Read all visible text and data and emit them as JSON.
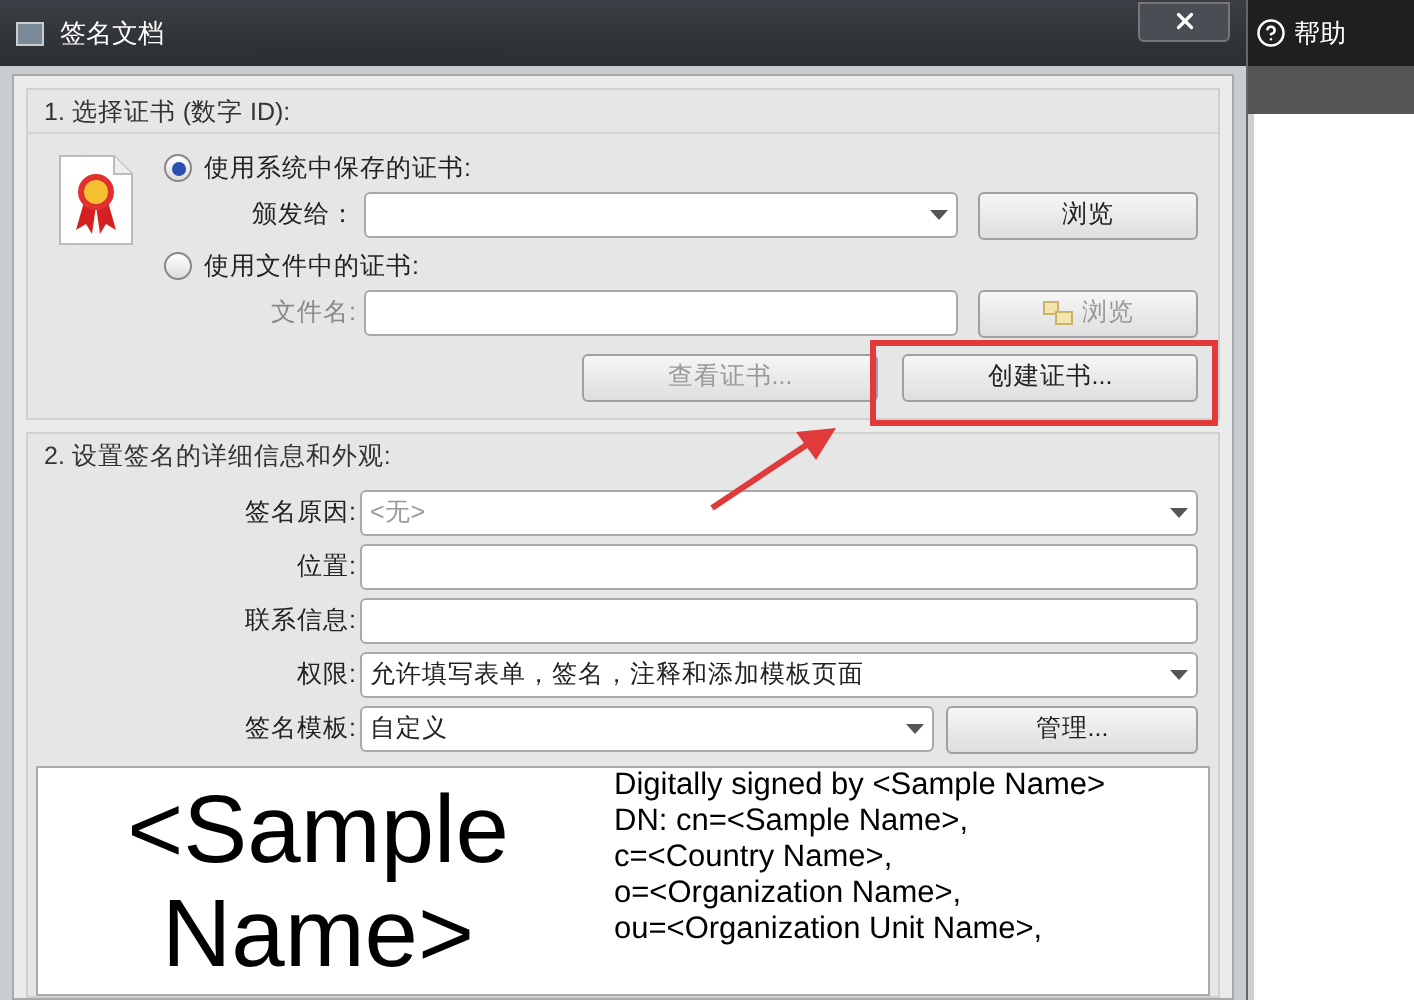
{
  "window": {
    "title": "签名文档"
  },
  "background_app": {
    "help": "帮助"
  },
  "certificate": {
    "title": "1. 选择证书 (数字 ID):",
    "options": [
      {
        "label": "使用系统中保存的证书:",
        "selected": true,
        "field_label": "颁发给：",
        "kind": "dropdown",
        "button": "浏览",
        "disabled": false
      },
      {
        "label": "使用文件中的证书:",
        "selected": false,
        "field_label": "文件名:",
        "kind": "text",
        "button": "浏览",
        "disabled": true
      }
    ],
    "buttons": [
      {
        "label": "查看证书...",
        "disabled": true,
        "highlighted": false
      },
      {
        "label": "创建证书...",
        "disabled": false,
        "highlighted": true
      }
    ]
  },
  "appearance": {
    "title": "2. 设置签名的详细信息和外观:",
    "rows": [
      {
        "label": "签名原因:",
        "kind": "dropdown",
        "placeholder": "<无>"
      },
      {
        "label": "位置:",
        "kind": "text"
      },
      {
        "label": "联系信息:",
        "kind": "text"
      },
      {
        "label": "权限:",
        "kind": "dropdown",
        "value": "允许填写表单，签名，注释和添加模板页面"
      },
      {
        "label": "签名模板:",
        "kind": "dropdown",
        "value": "自定义",
        "button": "管理..."
      }
    ],
    "preview": {
      "name": "<Sample Name>",
      "details": [
        "Digitally signed by <Sample Name>",
        "DN: cn=<Sample Name>,",
        "c=<Country Name>,",
        "o=<Organization Name>,",
        "ou=<Organization Unit Name>,"
      ]
    }
  }
}
